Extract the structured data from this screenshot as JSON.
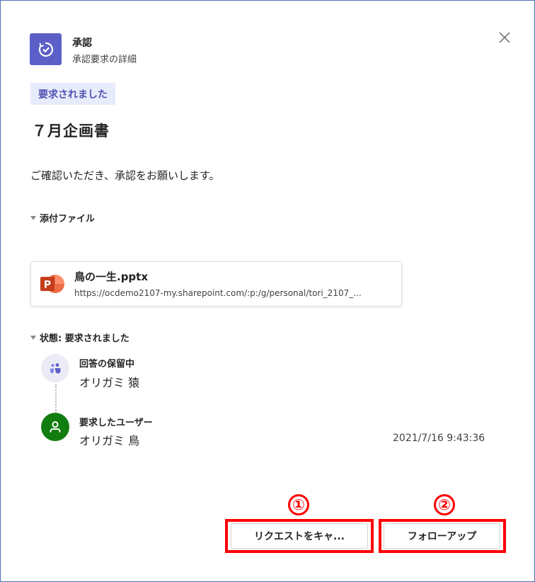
{
  "header": {
    "app_name": "承認",
    "app_subtitle": "承認要求の詳細",
    "app_icon": "approvals-icon",
    "close_icon": "close-icon"
  },
  "request": {
    "status_badge": "要求されました",
    "title": "７月企画書",
    "message": "ご確認いただき、承認をお願いします。"
  },
  "attachments": {
    "section_label": "添付ファイル",
    "files": [
      {
        "name": "鳥の一生.pptx",
        "url": "https://ocdemo2107-my.sharepoint.com/:p:/g/personal/tori_2107_...",
        "icon": "powerpoint-icon"
      }
    ]
  },
  "status": {
    "section_label": "状態: 要求されました",
    "timeline": [
      {
        "label": "回答の保留中",
        "name": "オリガミ 猿",
        "icon": "teams-people-icon",
        "time": ""
      },
      {
        "label": "要求したユーザー",
        "name": "オリガミ 鳥",
        "icon": "person-icon",
        "time": "2021/7/16 9:43:36"
      }
    ]
  },
  "actions": {
    "cancel_label": "リクエストをキャ...",
    "follow_up_label": "フォローアップ"
  },
  "annotations": {
    "marker_1": "①",
    "marker_2": "②",
    "color": "#ff0000"
  },
  "colors": {
    "accent": "#5b5fc7",
    "badge_bg": "#e8ebfa",
    "badge_text": "#4f52b2",
    "user_avatar": "#127d0f",
    "powerpoint": "#c43e1c"
  }
}
